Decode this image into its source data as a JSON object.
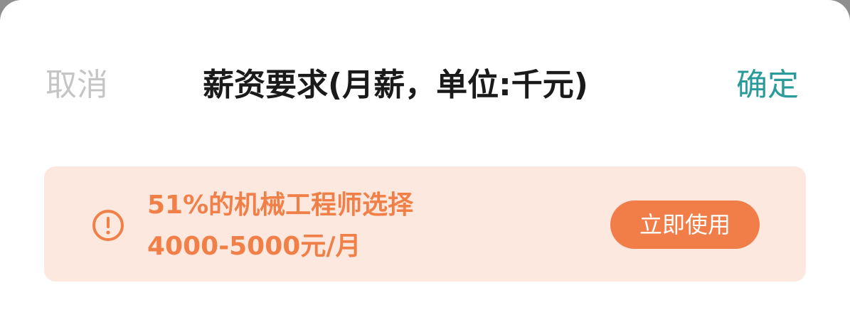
{
  "header": {
    "cancel_label": "取消",
    "title": "薪资要求(月薪，单位:千元)",
    "confirm_label": "确定"
  },
  "tip": {
    "icon": "exclamation-circle-icon",
    "line1": "51%的机械工程师选择",
    "line2": "4000-5000元/月",
    "button_label": "立即使用"
  },
  "colors": {
    "accent_teal": "#2b9a9a",
    "tip_background": "#fde8e0",
    "tip_text": "#f08048",
    "tip_button": "#f17d49",
    "cancel_text": "#c5c5c5",
    "title_text": "#1a1a1a"
  }
}
